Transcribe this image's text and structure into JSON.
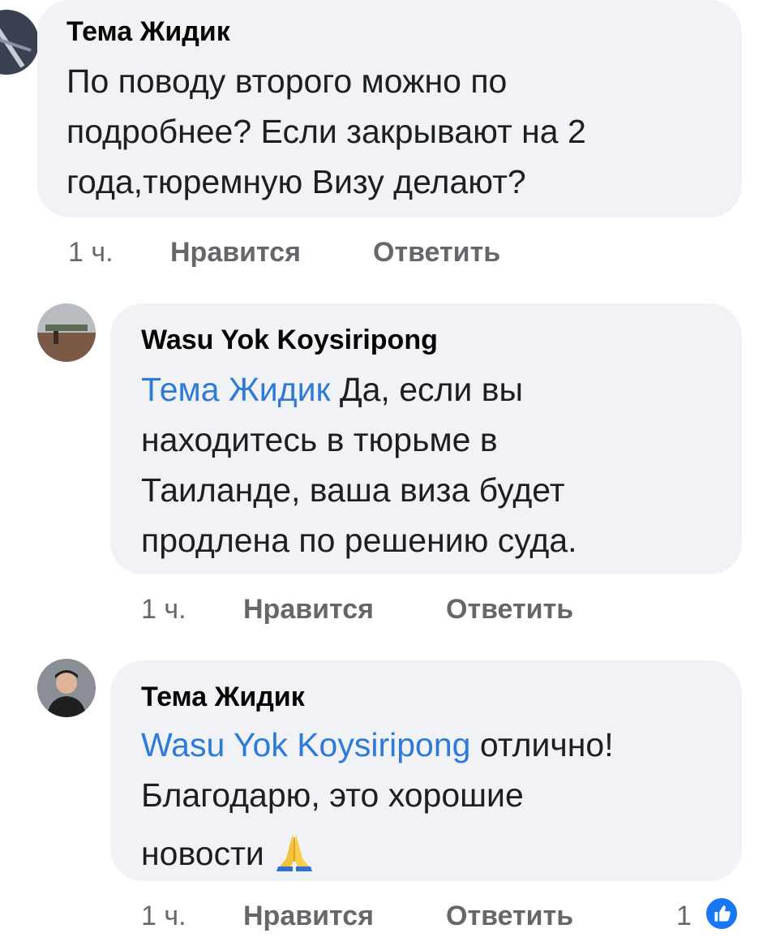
{
  "comments": [
    {
      "author": "Тема Жидик",
      "lines": [
        "По поводу второго можно по",
        "подробнее? Если закрывают на 2",
        "года,тюремную Визу делают?"
      ],
      "time": "1 ч.",
      "like_label": "Нравится",
      "reply_label": "Ответить"
    },
    {
      "author": "Wasu Yok Koysiripong",
      "mention": "Тема Жидик",
      "lines": [
        " Да, если вы",
        "находитесь в тюрьме в",
        "Таиланде, ваша виза будет",
        "продлена по решению суда."
      ],
      "time": "1 ч.",
      "like_label": "Нравится",
      "reply_label": "Ответить"
    },
    {
      "author": "Тема Жидик",
      "mention": "Wasu Yok Koysiripong",
      "lines": [
        " отлично!",
        "Благодарю, это хорошие",
        "новости "
      ],
      "emoji": "folded-hands-emoji",
      "time": "1 ч.",
      "like_label": "Нравится",
      "reply_label": "Ответить",
      "reaction_count": "1",
      "reaction_icon": "like-thumb-icon"
    }
  ],
  "colors": {
    "bubble": "#f0f2f5",
    "mention": "#2d7ad8",
    "meta": "#65676b",
    "like_badge": "#1877f2"
  }
}
